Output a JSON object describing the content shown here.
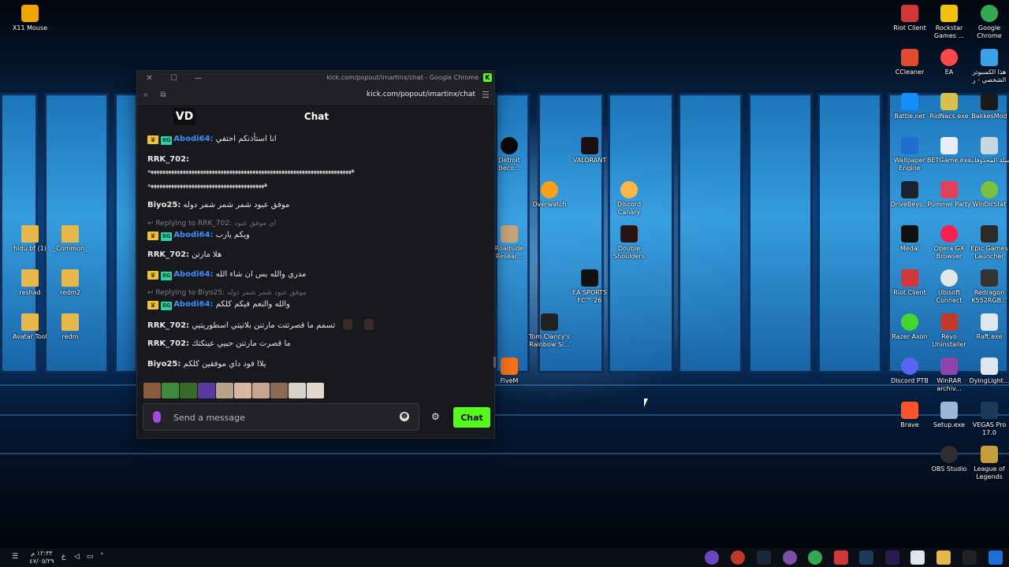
{
  "window": {
    "title": "kick.com/popout/imartinx/chat - Google Chrome",
    "url": "kick.com/popout/imartinx/chat",
    "kick_badge": "K"
  },
  "chat": {
    "header_title": "Chat",
    "channel_logo": "VD",
    "input_placeholder": "Send a message",
    "send_button": "Chat",
    "messages": [
      {
        "user": "Abodi64",
        "sep": ":",
        "text": "انا استأذنكم احتفي"
      },
      {
        "user": "RRK_702",
        "sep": ":",
        "text": "ههههههههههههههههههههههههههههههههههههههههههههههههههههههههههههههههههههههه"
      },
      {
        "user": "",
        "sep": "",
        "text": "ههههههههههههههههههههههههههههههههههههههههه"
      },
      {
        "user": "Biyo25",
        "sep": ":",
        "text": "موفق عبود شمر شمر شمر دوله"
      },
      {
        "reply_prefix": "Replying to RRK_702:",
        "reply_text": "اي موفق عبود"
      },
      {
        "user": "Abodi64",
        "sep": ":",
        "text": "ويكم يارب"
      },
      {
        "user": "RRK_702",
        "sep": ":",
        "text": "هلا مارتن"
      },
      {
        "user": "Abodi64",
        "sep": ":",
        "text": "مدري والله بس ان شاء الله"
      },
      {
        "reply_prefix": "Replying to Biyo25:",
        "reply_text": "موفق عبود شمر شمر دوله"
      },
      {
        "user": "Abodi64",
        "sep": ":",
        "text": "والله والنعم فيكم كلكم"
      },
      {
        "user": "RRK_702",
        "sep": ":",
        "text": "تسمم ما قصرتتت مارتنن بلاتيتي اسطوريتيي"
      },
      {
        "user": "RRK_702",
        "sep": ":",
        "text": "ما قصرت مارتنن حبيي عينكتك"
      },
      {
        "user": "Biyo25",
        "sep": ":",
        "text": "يلاا فود داي موفقين كلكم"
      }
    ]
  },
  "desktop_icons": [
    {
      "label": "X11 Mouse"
    },
    {
      "label": "Riot Client"
    },
    {
      "label": "Rockstar Games ..."
    },
    {
      "label": "Google Chrome"
    },
    {
      "label": "CCleaner"
    },
    {
      "label": "EA"
    },
    {
      "label": "هذا الكمبيوتر الشخصي - ر"
    },
    {
      "label": "Battle.net"
    },
    {
      "label": "RidNacs.exe"
    },
    {
      "label": "BakkesMod"
    },
    {
      "label": "Wallpaper Engine"
    },
    {
      "label": "BETGame.exe"
    },
    {
      "label": "سلة المحذوفات"
    },
    {
      "label": "DriveBeyo..."
    },
    {
      "label": "Pummel Party"
    },
    {
      "label": "WinDirStat"
    },
    {
      "label": "Medal"
    },
    {
      "label": "Opera GX Browser"
    },
    {
      "label": "Epic Games Launcher"
    },
    {
      "label": "Riot Client"
    },
    {
      "label": "Ubisoft Connect"
    },
    {
      "label": "Redragon K552RGB..."
    },
    {
      "label": "Razer Axon"
    },
    {
      "label": "Revo Uninstaller"
    },
    {
      "label": "Raft.exe"
    },
    {
      "label": "Discord PTB"
    },
    {
      "label": "WinRAR archiv..."
    },
    {
      "label": "DyingLight..."
    },
    {
      "label": "Brave"
    },
    {
      "label": "Setup.exe"
    },
    {
      "label": "VEGAS Pro 17.0"
    },
    {
      "label": "OBS Studio"
    },
    {
      "label": "League of Legends"
    },
    {
      "label": "Detroit Beco..."
    },
    {
      "label": "VALORANT"
    },
    {
      "label": "Overwatch"
    },
    {
      "label": "Discord Canary"
    },
    {
      "label": "Roadside Resear..."
    },
    {
      "label": "Double Shoulders"
    },
    {
      "label": "EA SPORTS FC™ 26"
    },
    {
      "label": "Tom Clancy's Rainbow Si..."
    },
    {
      "label": "FiveM"
    },
    {
      "label": "hidu.bf (1)"
    },
    {
      "label": "_Common_"
    },
    {
      "label": "reshad"
    },
    {
      "label": "redm2"
    },
    {
      "label": "Avatar Tool"
    },
    {
      "label": "redm"
    }
  ],
  "taskbar": {
    "time": "١٢:٣٣ م",
    "date": "٤٧/٠٥/٢٩",
    "lang": "ع"
  }
}
